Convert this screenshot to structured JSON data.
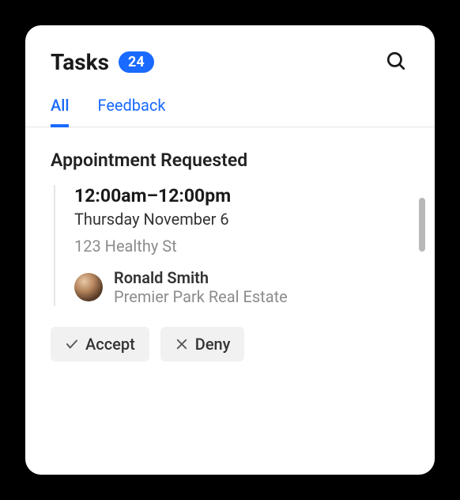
{
  "header": {
    "title": "Tasks",
    "badge_count": "24"
  },
  "tabs": [
    {
      "label": "All",
      "active": true
    },
    {
      "label": "Feedback",
      "active": false
    }
  ],
  "section": {
    "title": "Appointment Requested"
  },
  "appointment": {
    "time": "12:00am–12:00pm",
    "date": "Thursday November 6",
    "address": "123 Healthy St",
    "person": {
      "name": "Ronald Smith",
      "org": "Premier Park Real Estate"
    }
  },
  "actions": {
    "accept": "Accept",
    "deny": "Deny"
  }
}
